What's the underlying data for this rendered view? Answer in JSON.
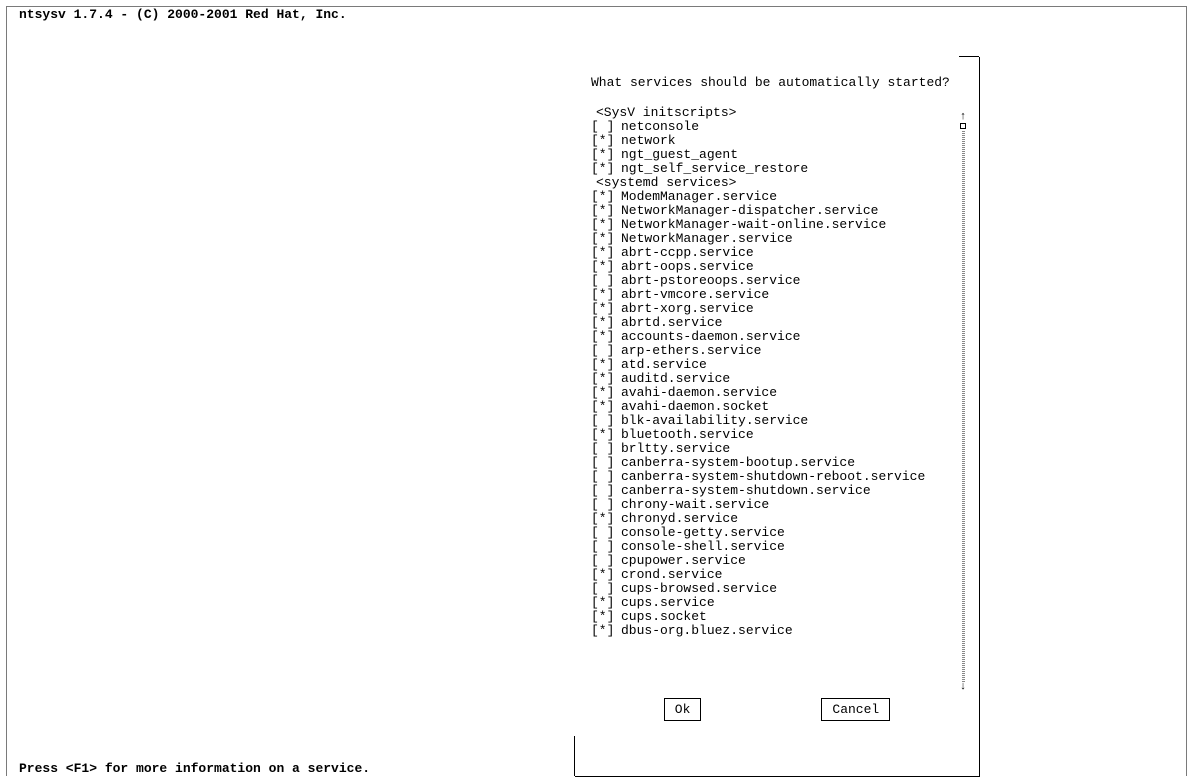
{
  "header": {
    "title": "ntsysv 1.7.4 - (C) 2000-2001 Red Hat, Inc."
  },
  "dialog": {
    "prompt": "What services should be automatically started?",
    "groups": [
      {
        "label": "<SysV initscripts>",
        "items": [
          {
            "checked": false,
            "name": "netconsole"
          },
          {
            "checked": true,
            "name": "network"
          },
          {
            "checked": true,
            "name": "ngt_guest_agent"
          },
          {
            "checked": true,
            "name": "ngt_self_service_restore"
          }
        ]
      },
      {
        "label": "<systemd services>",
        "items": [
          {
            "checked": true,
            "name": "ModemManager.service"
          },
          {
            "checked": true,
            "name": "NetworkManager-dispatcher.service"
          },
          {
            "checked": true,
            "name": "NetworkManager-wait-online.service"
          },
          {
            "checked": true,
            "name": "NetworkManager.service"
          },
          {
            "checked": true,
            "name": "abrt-ccpp.service"
          },
          {
            "checked": true,
            "name": "abrt-oops.service"
          },
          {
            "checked": false,
            "name": "abrt-pstoreoops.service"
          },
          {
            "checked": true,
            "name": "abrt-vmcore.service"
          },
          {
            "checked": true,
            "name": "abrt-xorg.service"
          },
          {
            "checked": true,
            "name": "abrtd.service"
          },
          {
            "checked": true,
            "name": "accounts-daemon.service"
          },
          {
            "checked": false,
            "name": "arp-ethers.service"
          },
          {
            "checked": true,
            "name": "atd.service"
          },
          {
            "checked": true,
            "name": "auditd.service"
          },
          {
            "checked": true,
            "name": "avahi-daemon.service"
          },
          {
            "checked": true,
            "name": "avahi-daemon.socket"
          },
          {
            "checked": false,
            "name": "blk-availability.service"
          },
          {
            "checked": true,
            "name": "bluetooth.service"
          },
          {
            "checked": false,
            "name": "brltty.service"
          },
          {
            "checked": false,
            "name": "canberra-system-bootup.service"
          },
          {
            "checked": false,
            "name": "canberra-system-shutdown-reboot.service"
          },
          {
            "checked": false,
            "name": "canberra-system-shutdown.service"
          },
          {
            "checked": false,
            "name": "chrony-wait.service"
          },
          {
            "checked": true,
            "name": "chronyd.service"
          },
          {
            "checked": false,
            "name": "console-getty.service"
          },
          {
            "checked": false,
            "name": "console-shell.service"
          },
          {
            "checked": false,
            "name": "cpupower.service"
          },
          {
            "checked": true,
            "name": "crond.service"
          },
          {
            "checked": false,
            "name": "cups-browsed.service"
          },
          {
            "checked": true,
            "name": "cups.service"
          },
          {
            "checked": true,
            "name": "cups.socket"
          },
          {
            "checked": true,
            "name": "dbus-org.bluez.service"
          }
        ]
      }
    ],
    "buttons": {
      "ok": "Ok",
      "cancel": "Cancel"
    }
  },
  "footer": {
    "hint": "Press <F1> for more information on a service."
  }
}
